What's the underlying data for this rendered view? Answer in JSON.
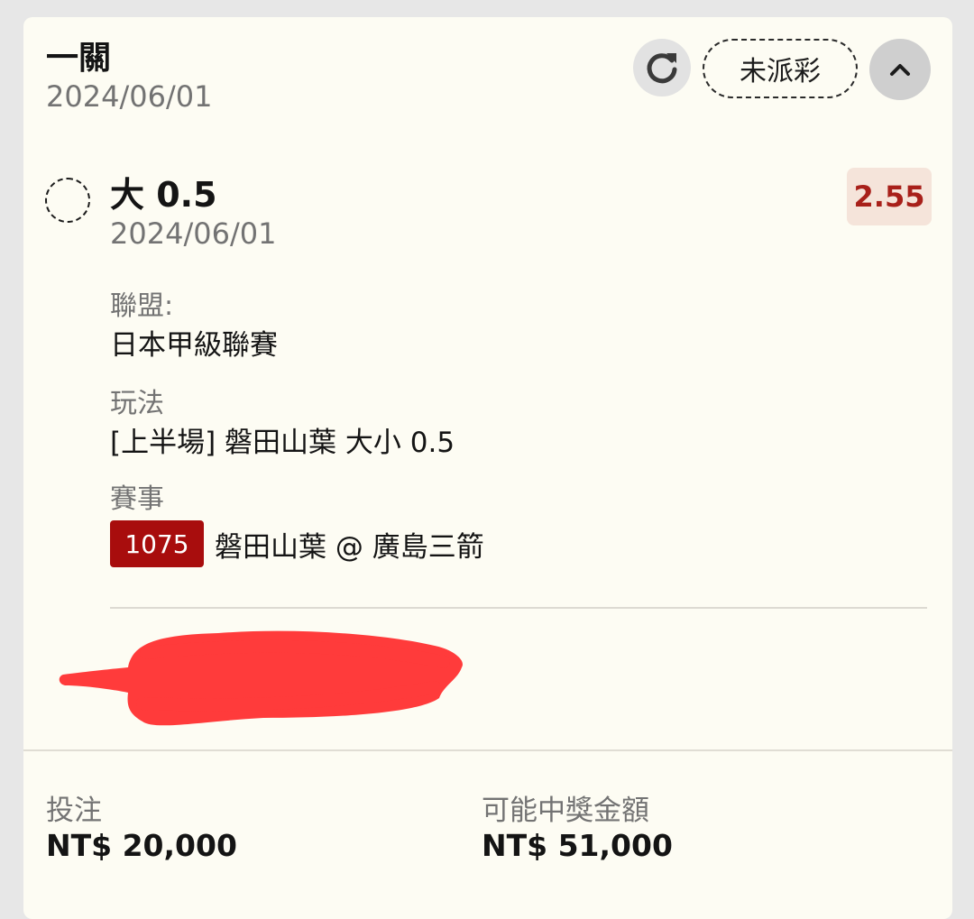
{
  "bet": {
    "type": "一關",
    "date": "2024/06/01",
    "status": "未派彩"
  },
  "selection": {
    "name": "大 0.5",
    "date": "2024/06/01",
    "odds": "2.55"
  },
  "details": {
    "league_label": "聯盟:",
    "league_value": "日本甲級聯賽",
    "play_label": "玩法",
    "play_value": "[上半場] 磐田山葉 大小 0.5",
    "match_label": "賽事",
    "match_id": "1075",
    "match_name": "磐田山葉 @ 廣島三箭"
  },
  "summary": {
    "stake_label": "投注",
    "stake_value": "NT$ 20,000",
    "payout_label": "可能中獎金額",
    "payout_value": "NT$ 51,000"
  },
  "colors": {
    "card_bg": "#fdfcf3",
    "odds_text": "#a8201a",
    "odds_bg": "#f5e4da",
    "badge_bg": "#a80d0d",
    "redaction": "#ff3b3b"
  },
  "icons": {
    "refresh": "refresh-icon",
    "collapse": "chevron-up-icon"
  }
}
